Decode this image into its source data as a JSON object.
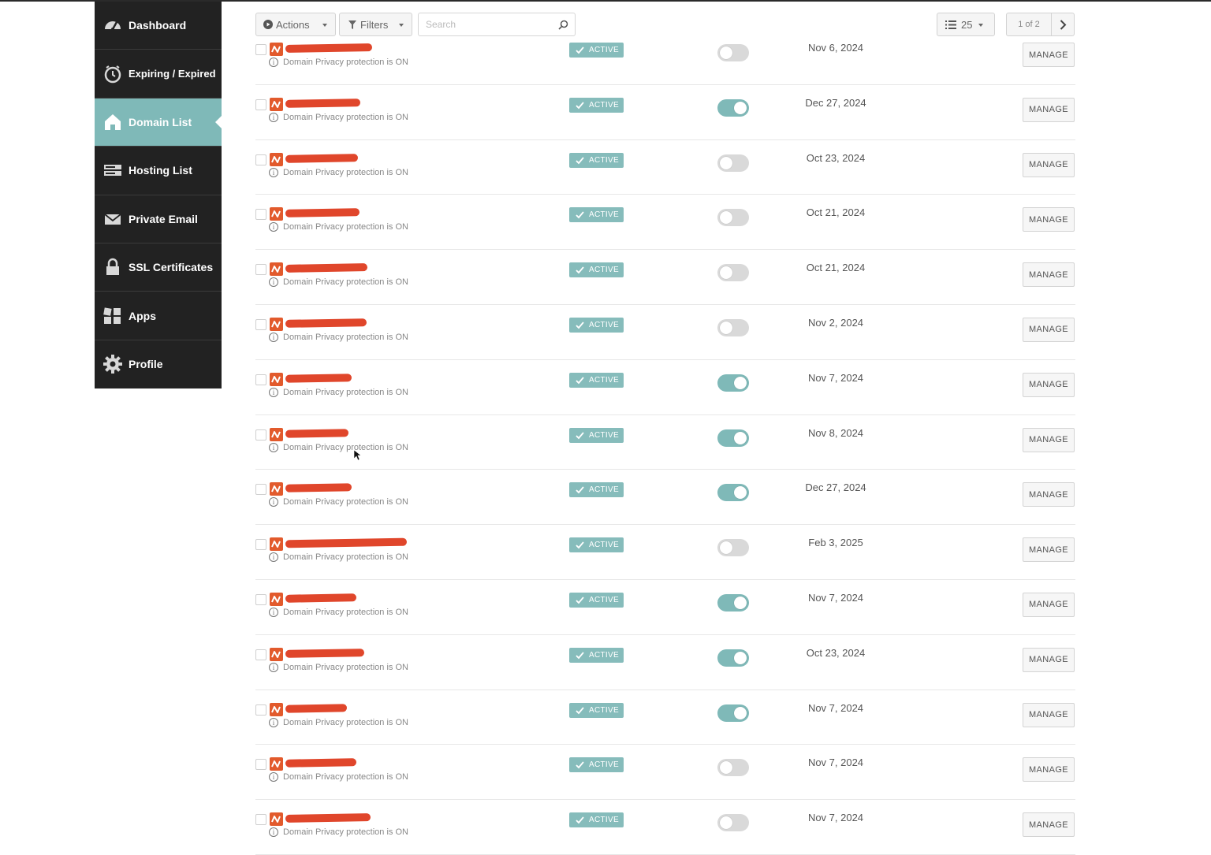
{
  "sidebar": {
    "items": [
      {
        "label": "Dashboard",
        "icon": "speedometer-icon"
      },
      {
        "label": "Expiring / Expired",
        "icon": "clock-icon"
      },
      {
        "label": "Domain List",
        "icon": "home-icon",
        "active": true
      },
      {
        "label": "Hosting List",
        "icon": "server-icon"
      },
      {
        "label": "Private Email",
        "icon": "envelope-icon"
      },
      {
        "label": "SSL Certificates",
        "icon": "lock-icon"
      },
      {
        "label": "Apps",
        "icon": "apps-grid-icon"
      },
      {
        "label": "Profile",
        "icon": "gear-icon"
      }
    ]
  },
  "toolbar": {
    "actions_label": "Actions",
    "filters_label": "Filters",
    "search_placeholder": "Search",
    "per_page_value": "25",
    "pagination_label": "1 of 2"
  },
  "rows": [
    {
      "privacy": "Domain Privacy protection is ON",
      "status": "ACTIVE",
      "auto_renew": false,
      "date": "Nov 6, 2024",
      "manage": "MANAGE"
    },
    {
      "privacy": "Domain Privacy protection is ON",
      "status": "ACTIVE",
      "auto_renew": true,
      "date": "Dec 27, 2024",
      "manage": "MANAGE"
    },
    {
      "privacy": "Domain Privacy protection is ON",
      "status": "ACTIVE",
      "auto_renew": false,
      "date": "Oct 23, 2024",
      "manage": "MANAGE"
    },
    {
      "privacy": "Domain Privacy protection is ON",
      "status": "ACTIVE",
      "auto_renew": false,
      "date": "Oct 21, 2024",
      "manage": "MANAGE"
    },
    {
      "privacy": "Domain Privacy protection is ON",
      "status": "ACTIVE",
      "auto_renew": false,
      "date": "Oct 21, 2024",
      "manage": "MANAGE"
    },
    {
      "privacy": "Domain Privacy protection is ON",
      "status": "ACTIVE",
      "auto_renew": false,
      "date": "Nov 2, 2024",
      "manage": "MANAGE"
    },
    {
      "privacy": "Domain Privacy protection is ON",
      "status": "ACTIVE",
      "auto_renew": true,
      "date": "Nov 7, 2024",
      "manage": "MANAGE"
    },
    {
      "privacy": "Domain Privacy protection is ON",
      "status": "ACTIVE",
      "auto_renew": true,
      "date": "Nov 8, 2024",
      "manage": "MANAGE"
    },
    {
      "privacy": "Domain Privacy protection is ON",
      "status": "ACTIVE",
      "auto_renew": true,
      "date": "Dec 27, 2024",
      "manage": "MANAGE"
    },
    {
      "privacy": "Domain Privacy protection is ON",
      "status": "ACTIVE",
      "auto_renew": false,
      "date": "Feb 3, 2025",
      "manage": "MANAGE"
    },
    {
      "privacy": "Domain Privacy protection is ON",
      "status": "ACTIVE",
      "auto_renew": true,
      "date": "Nov 7, 2024",
      "manage": "MANAGE"
    },
    {
      "privacy": "Domain Privacy protection is ON",
      "status": "ACTIVE",
      "auto_renew": true,
      "date": "Oct 23, 2024",
      "manage": "MANAGE"
    },
    {
      "privacy": "Domain Privacy protection is ON",
      "status": "ACTIVE",
      "auto_renew": true,
      "date": "Nov 7, 2024",
      "manage": "MANAGE"
    },
    {
      "privacy": "Domain Privacy protection is ON",
      "status": "ACTIVE",
      "auto_renew": false,
      "date": "Nov 7, 2024",
      "manage": "MANAGE"
    },
    {
      "privacy": "Domain Privacy protection is ON",
      "status": "ACTIVE",
      "auto_renew": false,
      "date": "Nov 7, 2024",
      "manage": "MANAGE"
    }
  ],
  "colors": {
    "sidebar_bg": "#222222",
    "sidebar_active": "#7fb9b8",
    "status_badge": "#86bcbb",
    "toggle_on": "#7fb9b8",
    "brand_icon": "#e25a2c",
    "redaction": "#e0462b"
  }
}
